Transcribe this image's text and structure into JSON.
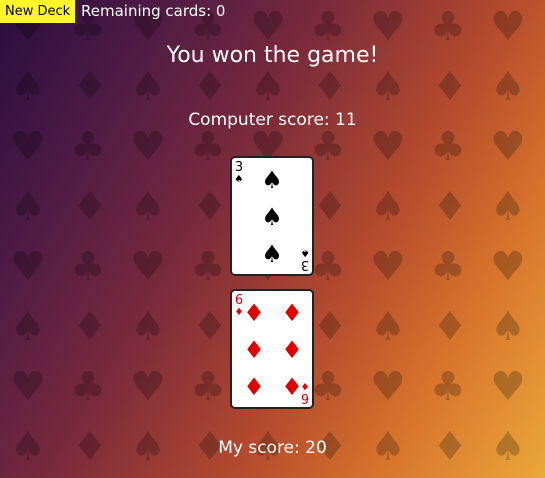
{
  "toolbar": {
    "new_deck_label": "New Deck",
    "remaining_label": "Remaining cards: 0"
  },
  "game": {
    "message": "You won the game!",
    "computer_score_label": "Computer score: 11",
    "my_score_label": "My score: 20"
  },
  "computer_card": {
    "rank": "3",
    "suit_icon": "spade-icon",
    "suit_glyph": "♠",
    "color": "#000000"
  },
  "my_card": {
    "rank": "6",
    "suit_icon": "diamond-icon",
    "suit_glyph": "♦",
    "color": "#e00000"
  }
}
